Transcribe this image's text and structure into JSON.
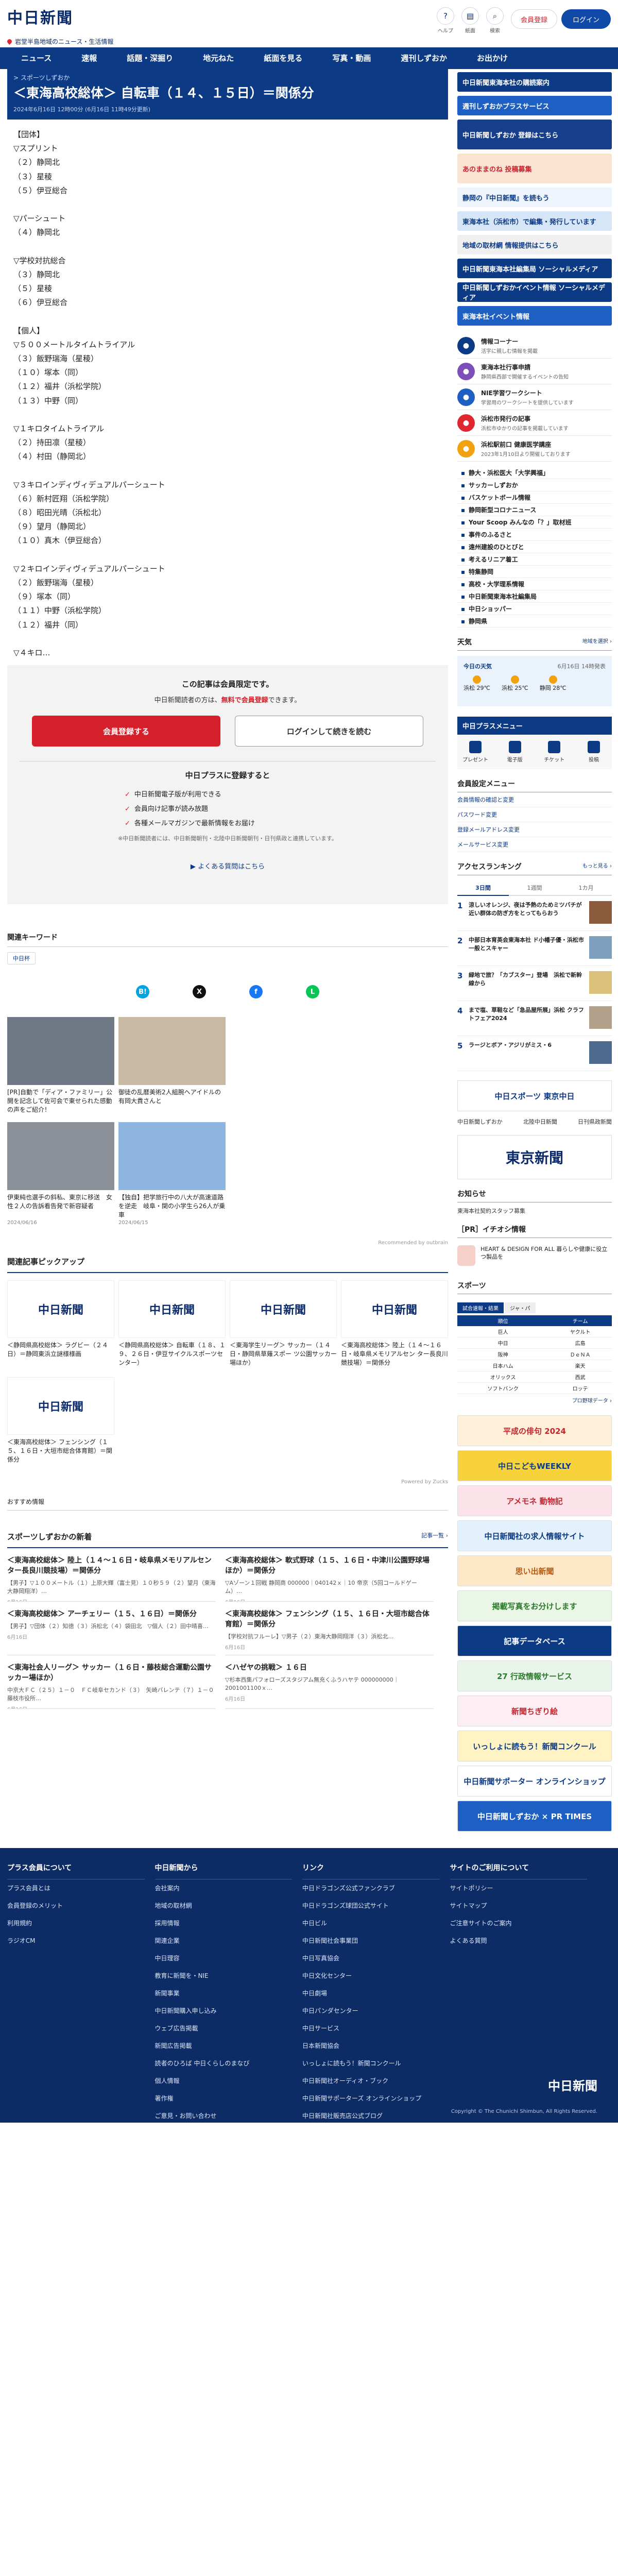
{
  "header": {
    "logo": "中日新聞",
    "subtitle": "岩堂半島地域のニュース・生活情報",
    "icons": [
      {
        "label": "ヘルプ",
        "icon": "help-icon",
        "glyph": "?"
      },
      {
        "label": "紙面",
        "icon": "paper-icon",
        "glyph": "▤"
      },
      {
        "label": "検索",
        "icon": "search-icon",
        "glyph": "⌕"
      }
    ],
    "signup_label": "会員登録",
    "login_label": "ログイン"
  },
  "nav": [
    "ニュース",
    "速報",
    "話題・深掘り",
    "地元ねた",
    "紙面を見る",
    "写真・動画",
    "週刊しずおか",
    "お出かけ"
  ],
  "article": {
    "breadcrumb": "> スポーツしずおか",
    "title": "＜東海高校総体＞ 自転車（１４、１５日）＝関係分",
    "date": "2024年6月16日 12時00分 (6月16日 11時49分更新)",
    "lines": [
      "【団体】",
      "▽スプリント",
      "（２）静岡北",
      "（３）星稜",
      "（５）伊豆総合",
      "",
      "▽パーシュート",
      "（４）静岡北",
      "",
      "▽学校対抗総合",
      "（３）静岡北",
      "（５）星稜",
      "（６）伊豆総合",
      "",
      "【個人】",
      "▽５００メートルタイムトライアル",
      "（３）飯野瑞海（星稜）",
      "（１０）塚本（同）",
      "（１２）福井（浜松学院）",
      "（１３）中野（同）",
      "",
      "▽１キロタイムトライアル",
      "（２）持田凛（星稜）",
      "（４）村田（静岡北）",
      "",
      "▽３キロインディヴィデュアルパーシュート",
      "（６）新村匠翔（浜松学院）",
      "（８）昭田光晴（浜松北）",
      "（９）望月（静岡北）",
      "（１０）真木（伊豆総合）",
      "",
      "▽２キロインディヴィデュアルパーシュート",
      "（２）飯野瑞海（星稜）",
      "（９）塚本（同）",
      "（１１）中野（浜松学院）",
      "（１２）福井（同）",
      "",
      "▽４キロ…"
    ]
  },
  "paywall": {
    "title": "この記事は会員限定です。",
    "desc_prefix": "中日新聞読者の方は、",
    "desc_link": "無料で会員登録",
    "desc_suffix": "できます。",
    "register_label": "会員登録する",
    "login_label": "ログインして続きを読む",
    "plus_title": "中日プラスに登録すると",
    "benefits": [
      "中日新聞電子版が利用できる",
      "会員向け記事が読み放題",
      "各種メールマガジンで最新情報をお届け"
    ],
    "note": "※中日新聞読者には、中日新聞朝刊・北陸中日新聞朝刊・日刊県政と連携しています。",
    "faq_label": "よくある質問はこちら"
  },
  "keywords": {
    "label": "関連キーワード",
    "tags": [
      "中日杯"
    ]
  },
  "share": [
    {
      "icon": "hatena-icon",
      "glyph": "B!",
      "color": "#00a4de"
    },
    {
      "icon": "x-icon",
      "glyph": "X",
      "color": "#111111"
    },
    {
      "icon": "facebook-icon",
      "glyph": "f",
      "color": "#1877f2"
    },
    {
      "icon": "line-icon",
      "glyph": "L",
      "color": "#06c755"
    }
  ],
  "recommend": {
    "items": [
      {
        "caption": "[PR]自動で「ディア・ファミリー」公開を記念して佐可会で東せられた感動の声をご紹介！",
        "source": "",
        "color": "#6f7a86"
      },
      {
        "caption": "御徒の乱暦美術2人組腕へアイドルの有岡大貴さんと",
        "source": "",
        "color": "#c9b8a4"
      },
      {
        "caption": "",
        "source": "",
        "color": "#ffffff"
      },
      {
        "caption": "",
        "source": "",
        "color": "#ffffff"
      },
      {
        "caption": "伊東純也選手の斜私、東京に移送　女性２人の告訴看告発で新容疑者",
        "source": "2024/06/16",
        "color": "#8a8f98"
      },
      {
        "caption": "【独自】把学旅行中の八大が高速道路を逆走　岐阜・関の小学生ら26人が乗車",
        "source": "2024/06/15",
        "color": "#8db5e0"
      },
      {
        "caption": "",
        "source": "",
        "color": "#ffffff"
      },
      {
        "caption": "",
        "source": "",
        "color": "#ffffff"
      }
    ],
    "credit": "Recommended by outbrain"
  },
  "pickup": {
    "title": "関連記事ピックアップ",
    "logo_text": "中日新聞",
    "items": [
      "＜静岡県高校総体＞ ラグビー（２４日）＝静岡東浜立謎様様画",
      "＜静岡県高校総体＞ 自転車（１８、１９、２６日・伊豆サイクルスポーツセンター）",
      "＜東海学生リーグ＞ サッカー（１４日・静岡県草薙スポー ツ公園サッカー場ほか）",
      "＜東海高校総体＞ 陸上（１４～１６日・岐阜県メモリアルセン ター長良川競技場）＝関係分",
      "＜東海高校総体＞ フェンシング（１５、１６日・大垣市総合体育館）＝関係分"
    ],
    "credit": "Powered by Zucks",
    "osusume": "おすすめ情報"
  },
  "latest": {
    "title": "スポーツしずおかの新着",
    "more": "記事一覧 ›",
    "items": [
      {
        "title": "＜東海高校総体＞ 陸上（１４～１６日・岐阜県メモリアルセンター長良川競技場）＝関係分",
        "excerpt": "【男子】▽１００メートル（１）上原大輝（富士見）１０秒５９（２）望月（東海大静岡翔洋）…",
        "date": "6月16日"
      },
      {
        "title": "＜東海高校総体＞ 軟式野球（１５、１６日・中津川公園野球場ほか）＝関係分",
        "excerpt": "▽Aゾーン１回戦 静岡商 000000｜040142ｘ｜10 帝京（5回コールドゲーム）…",
        "date": "6月16日"
      },
      {
        "title": "＜東海高校総体＞ アーチェリー（１５、１６日）＝関係分",
        "excerpt": "【男子】▽団体（２）知徳（３）浜松北（４）袋田北　▽個人（２）田中晴喜…",
        "date": "6月16日"
      },
      {
        "title": "＜東海高校総体＞ フェンシング（１５、１６日・大垣市総合体育館）＝関係分",
        "excerpt": "【学校対抗フルーレ】▽男子（２）東海大静岡翔洋（３）浜松北…",
        "date": "6月16日"
      },
      {
        "title": "＜東海社会人リーグ＞ サッカー（１６日・藤枝総合運動公園サッカー場ほか）",
        "excerpt": "中京大ＦＣ（２５）１－０　ＦＣ岐阜セカンド（３）　矢崎バレンテ（７）１－０　藤枝市役所…",
        "date": "6月16日"
      },
      {
        "title": "＜ハゼヤの挑戦＞ １６日",
        "excerpt": "▽杉本西集パフォローズスタジアム無充くふうハヤテ 000000000｜2001001100ｘ…",
        "date": "6月16日"
      }
    ]
  },
  "sidebar": {
    "banners": [
      {
        "label": "中日新聞東海本社の購読案内",
        "bg": "#0d3a85",
        "fg": "#ffffff",
        "tall": false
      },
      {
        "label": "週刊しずおかプラスサービス",
        "bg": "#1d5fc2",
        "fg": "#ffffff",
        "tall": false
      },
      {
        "label": "中日新聞しずおか 登録はこちら",
        "bg": "#163e8a",
        "fg": "#ffffff",
        "tall": true
      },
      {
        "label": "あのままのね 投稿募集",
        "bg": "#fbe3d2",
        "fg": "#c4262e",
        "tall": true
      },
      {
        "label": "静岡の『中日新聞』を読もう",
        "bg": "#eef4fb",
        "fg": "#0d3a85",
        "tall": false
      },
      {
        "label": "東海本社（浜松市）で編集・発行しています",
        "bg": "#d7e6f6",
        "fg": "#0d3a85",
        "tall": false
      },
      {
        "label": "地域の取材網 情報提供はこちら",
        "bg": "#f0f0f0",
        "fg": "#0d3a85",
        "tall": false
      },
      {
        "label": "中日新聞東海本社編集局 ソーシャルメディア",
        "bg": "#0d3a85",
        "fg": "#ffffff",
        "tall": false
      },
      {
        "label": "中日新聞しずおかイベント情報 ソーシャルメディア",
        "bg": "#0d3a85",
        "fg": "#ffffff",
        "tall": false
      },
      {
        "label": "東海本社イベント情報",
        "bg": "#1d5fc2",
        "fg": "#ffffff",
        "tall": false
      }
    ],
    "events": [
      {
        "title": "情報コーナー",
        "desc": "活字に親しむ情報を掲載",
        "icon": "info-icon",
        "color": "#0d3a85"
      },
      {
        "title": "東海本社行事申請",
        "desc": "静岡県西部で開催するイベントの告知",
        "icon": "calendar-icon",
        "color": "#7d4fb8"
      },
      {
        "title": "NIE学習ワークシート",
        "desc": "学習用のワークシートを提供しています",
        "icon": "worksheet-icon",
        "color": "#1d5fc2"
      },
      {
        "title": "浜松市発行の記事",
        "desc": "浜松市ゆかりの記事を掲載しています",
        "icon": "city-icon",
        "color": "#e0262e"
      },
      {
        "title": "浜松駅前口 健康医学講座",
        "desc": "2023年1月10日より開催しております",
        "icon": "health-icon",
        "color": "#f3a20f"
      }
    ],
    "categories": [
      "静大・浜松医大「大学興福」",
      "サッカーしずおか",
      "バスケットボール情報",
      "静岡新型コロナニュース",
      "Your Scoop みんなの「？」取材班",
      "事件のふるさと",
      "遠州建設のひとびと",
      "考えるリニア着工",
      "特集静岡",
      "高校・大学理系情報",
      "中日新聞東海本社編集局",
      "中日ショッパー",
      "静岡県"
    ],
    "weather": {
      "head": "天気",
      "more": "地域を選択 ›",
      "date": "6月16日 14時発表",
      "today": "今日の天気",
      "cities": [
        {
          "name": "浜松",
          "temp": "29℃"
        },
        {
          "name": "浜松",
          "temp": "25℃"
        },
        {
          "name": "静岡",
          "temp": "28℃"
        }
      ]
    },
    "plus_menu": {
      "head": "中日プラスメニュー",
      "items": [
        "プレゼント",
        "電子版",
        "チケット",
        "投稿"
      ]
    },
    "member_menu": {
      "head": "会員設定メニュー",
      "items": [
        "会員情報の確認と変更",
        "パスワード変更",
        "登録メールアドレス変更",
        "メールサービス変更"
      ]
    },
    "ranking": {
      "head": "アクセスランキング",
      "more": "もっと見る ›",
      "tabs": [
        "3日間",
        "1週間",
        "1カ月"
      ],
      "items": [
        "涼しいオレンジ、夜は予熱のためミツバチが近い群体の防ぎ方をとってもらおう",
        "中部日本育英会東海本社 ド小幡子優・浜松市一般とスキャー",
        "緑地で旅？「カブスター」登場　浜松で新幹線から",
        "まで塩、草鞋など「急品屋所展」浜松 クラフトフェア2024",
        "ラージとボア・アジリがミス・6"
      ]
    },
    "ad_chunichi": "中日スポーツ 東京中日",
    "links": [
      "中日新聞しずおか",
      "北陸中日新聞",
      "日刊県政新聞"
    ],
    "tokyo": "東京新聞",
    "oshirase": {
      "head": "お知らせ",
      "text": "東海本社契約スタッフ募集"
    },
    "iina": {
      "head": "［PR］イチオシ情報",
      "text": "HEART & DESIGN FOR ALL 暮らしや健康に役立つ製品を"
    },
    "sports_head": "スポーツ",
    "baseball": {
      "tabs": [
        "試合速報・結果",
        "ジャ・パ"
      ],
      "headers": [
        "順位",
        "チーム"
      ],
      "rows": [
        [
          "巨人",
          "ヤクルト"
        ],
        [
          "中日",
          "広島"
        ],
        [
          "阪神",
          "ＤｅＮＡ"
        ],
        [
          "日本ハム",
          "楽天"
        ],
        [
          "オリックス",
          "西武"
        ],
        [
          "ソフトバンク",
          "ロッテ"
        ]
      ],
      "link": "プロ野球データ ›"
    },
    "services": [
      {
        "label": "平成の俳句 2024",
        "bg": "#fff0d9",
        "fg": "#c4262e"
      },
      {
        "label": "中日こどもWEEKLY",
        "bg": "#f7d23a",
        "fg": "#0d3a85"
      },
      {
        "label": "アメモネ 動物記",
        "bg": "#fce3ea",
        "fg": "#c4262e"
      },
      {
        "label": "中日新聞社の求人情報サイト",
        "bg": "#e2f1fb",
        "fg": "#0d3a85"
      },
      {
        "label": "思い出新聞",
        "bg": "#fde9c8",
        "fg": "#b55a10"
      },
      {
        "label": "掲載写真をお分けします",
        "bg": "#eaf7e6",
        "fg": "#2a7a2a"
      },
      {
        "label": "記事データベース",
        "bg": "#0d3a85",
        "fg": "#ffffff"
      },
      {
        "label": "27 行政情報サービス",
        "bg": "#e9f5ea",
        "fg": "#2a7a2a"
      },
      {
        "label": "新聞ちぎり絵",
        "bg": "#fdeef3",
        "fg": "#c4262e"
      },
      {
        "label": "いっしょに読もう！新聞コンクール",
        "bg": "#fff3c4",
        "fg": "#0d3a85"
      },
      {
        "label": "中日新聞サポーター オンラインショップ",
        "bg": "#ffffff",
        "fg": "#0d3a85"
      },
      {
        "label": "中日新聞しずおか × PR TIMES",
        "bg": "#1d5fc2",
        "fg": "#ffffff"
      }
    ]
  },
  "footer": {
    "columns": [
      {
        "head": "プラス会員について",
        "items": [
          "プラス会員とは",
          "会員登録のメリット",
          "利用規約",
          "ラジオCM"
        ]
      },
      {
        "head": "中日新聞から",
        "items": [
          "会社案内",
          "地域の取材網",
          "採用情報",
          "関連企業",
          "中日理容",
          "教育に新聞を・NIE",
          "新聞事業",
          "中日新聞購入申し込み",
          "ウェブ広告掲載",
          "新聞広告掲載",
          "読者のひろば 中日くらしのまなび",
          "個人情報",
          "著作権",
          "ご意見・お問い合わせ"
        ]
      },
      {
        "head": "リンク",
        "items": [
          "中日ドラゴンズ公式ファンクラブ",
          "中日ドラゴンズ球団公式サイト",
          "中日ビル",
          "中日新聞社会事業団",
          "中日写真協会",
          "中日文化センター",
          "中日劇場",
          "中日パンダセンター",
          "中日サービス",
          "日本新聞協会",
          "いっしょに読もう！新聞コンクール",
          "中日新聞社オーディオ・ブック",
          "中日新聞サポーターズ オンラインショップ",
          "中日新聞社販売店公式ブログ"
        ]
      },
      {
        "head": "サイトのご利用について",
        "items": [
          "サイトポリシー",
          "サイトマップ",
          "ご注意サイトのご案内",
          "よくある質問"
        ]
      }
    ],
    "logo": "中日新聞",
    "copyright": "Copyright © The Chunichi Shimbun, All Rights Reserved."
  }
}
